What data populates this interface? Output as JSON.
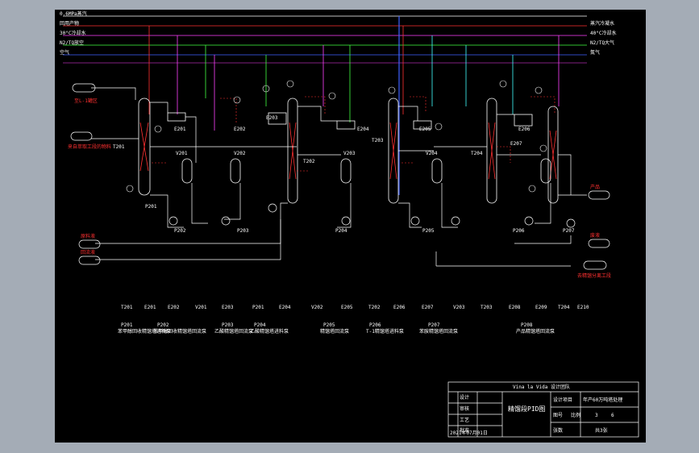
{
  "utility_lines": [
    {
      "label": "0.6MPa蒸汽",
      "color": "#ffffff"
    },
    {
      "label": "回用产物",
      "color": "#ff3030"
    },
    {
      "label": "30°C冷却水",
      "color": "#ff40ff"
    },
    {
      "label": "N2/TQ放空",
      "color": "#40ff40"
    },
    {
      "label": "空气",
      "color": "#4060ff"
    }
  ],
  "utility_returns": [
    "蒸汽冷凝水",
    "40°C冷却水",
    "N2/TQ大气",
    "氮气"
  ],
  "tower_labels": [
    "T201",
    "T202",
    "T203",
    "T204"
  ],
  "equipment_labels": [
    "E201",
    "E202",
    "E203",
    "E204",
    "E205",
    "E206",
    "E207",
    "V201",
    "V202",
    "V203",
    "V204",
    "P201",
    "P202",
    "P203",
    "P204",
    "P205",
    "P206",
    "P207"
  ],
  "io_labels": {
    "top_left_out": "至L-1罐区",
    "feed_in": "来自萃取工段的物料",
    "left_in_1": "原料液",
    "left_in_2": "回流液",
    "right_out_1": "产品",
    "right_out_2": "废液",
    "right_out_3": "去精馏分离工段"
  },
  "legend_header": [
    "T201",
    "E201",
    "E202",
    "V201",
    "E203",
    "P201",
    "E204",
    "V202",
    "E205",
    "T202",
    "E206",
    "E207",
    "V203",
    "T203",
    "E208",
    "E209",
    "T204",
    "E210"
  ],
  "legend_rows": [
    {
      "code": "P201",
      "name": "苯甲醇回收精馏塔进料泵"
    },
    {
      "code": "P202",
      "name": "苯甲醇回收精馏塔回流泵"
    },
    {
      "code": "P203",
      "name": "乙酸精馏塔回流泵"
    },
    {
      "code": "P204",
      "name": "乙酸精馏塔进料泵"
    },
    {
      "code": "P205",
      "name": "精馏塔回流泵"
    },
    {
      "code": "P206",
      "name": "T-1精馏塔进料泵"
    },
    {
      "code": "P207",
      "name": "苯胺精馏塔回流泵"
    },
    {
      "code": "P208",
      "name": "产品精馏塔回流泵"
    }
  ],
  "title_block": {
    "stamp": "Vina la Vida 设计团队",
    "left_rows": [
      "设计",
      "审核",
      "工艺",
      "批准"
    ],
    "drawing_name": "精馏段PID图",
    "project_label": "设计项目",
    "project_value": "年产60万吨塔处理",
    "date": "2021年07月01日",
    "drawing_no_label": "图号",
    "drawing_no_value": "3",
    "scale_label": "比例",
    "scale_value": "6",
    "sheet_label": "张数",
    "sheet_value": "共3张"
  }
}
